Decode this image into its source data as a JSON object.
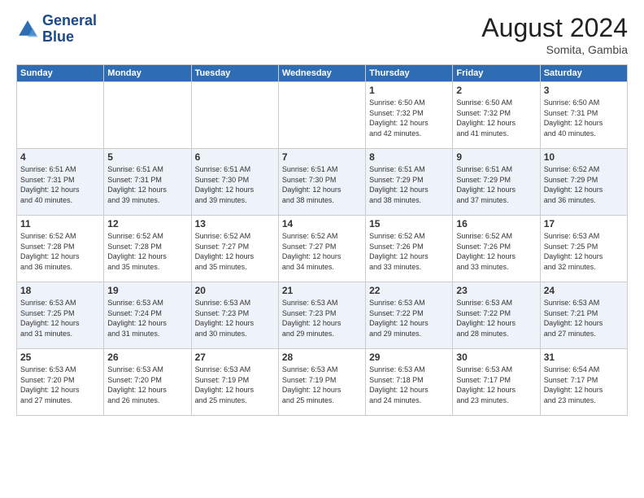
{
  "header": {
    "logo_line1": "General",
    "logo_line2": "Blue",
    "month_year": "August 2024",
    "location": "Somita, Gambia"
  },
  "weekdays": [
    "Sunday",
    "Monday",
    "Tuesday",
    "Wednesday",
    "Thursday",
    "Friday",
    "Saturday"
  ],
  "weeks": [
    [
      {
        "day": "",
        "info": ""
      },
      {
        "day": "",
        "info": ""
      },
      {
        "day": "",
        "info": ""
      },
      {
        "day": "",
        "info": ""
      },
      {
        "day": "1",
        "info": "Sunrise: 6:50 AM\nSunset: 7:32 PM\nDaylight: 12 hours\nand 42 minutes."
      },
      {
        "day": "2",
        "info": "Sunrise: 6:50 AM\nSunset: 7:32 PM\nDaylight: 12 hours\nand 41 minutes."
      },
      {
        "day": "3",
        "info": "Sunrise: 6:50 AM\nSunset: 7:31 PM\nDaylight: 12 hours\nand 40 minutes."
      }
    ],
    [
      {
        "day": "4",
        "info": "Sunrise: 6:51 AM\nSunset: 7:31 PM\nDaylight: 12 hours\nand 40 minutes."
      },
      {
        "day": "5",
        "info": "Sunrise: 6:51 AM\nSunset: 7:31 PM\nDaylight: 12 hours\nand 39 minutes."
      },
      {
        "day": "6",
        "info": "Sunrise: 6:51 AM\nSunset: 7:30 PM\nDaylight: 12 hours\nand 39 minutes."
      },
      {
        "day": "7",
        "info": "Sunrise: 6:51 AM\nSunset: 7:30 PM\nDaylight: 12 hours\nand 38 minutes."
      },
      {
        "day": "8",
        "info": "Sunrise: 6:51 AM\nSunset: 7:29 PM\nDaylight: 12 hours\nand 38 minutes."
      },
      {
        "day": "9",
        "info": "Sunrise: 6:51 AM\nSunset: 7:29 PM\nDaylight: 12 hours\nand 37 minutes."
      },
      {
        "day": "10",
        "info": "Sunrise: 6:52 AM\nSunset: 7:29 PM\nDaylight: 12 hours\nand 36 minutes."
      }
    ],
    [
      {
        "day": "11",
        "info": "Sunrise: 6:52 AM\nSunset: 7:28 PM\nDaylight: 12 hours\nand 36 minutes."
      },
      {
        "day": "12",
        "info": "Sunrise: 6:52 AM\nSunset: 7:28 PM\nDaylight: 12 hours\nand 35 minutes."
      },
      {
        "day": "13",
        "info": "Sunrise: 6:52 AM\nSunset: 7:27 PM\nDaylight: 12 hours\nand 35 minutes."
      },
      {
        "day": "14",
        "info": "Sunrise: 6:52 AM\nSunset: 7:27 PM\nDaylight: 12 hours\nand 34 minutes."
      },
      {
        "day": "15",
        "info": "Sunrise: 6:52 AM\nSunset: 7:26 PM\nDaylight: 12 hours\nand 33 minutes."
      },
      {
        "day": "16",
        "info": "Sunrise: 6:52 AM\nSunset: 7:26 PM\nDaylight: 12 hours\nand 33 minutes."
      },
      {
        "day": "17",
        "info": "Sunrise: 6:53 AM\nSunset: 7:25 PM\nDaylight: 12 hours\nand 32 minutes."
      }
    ],
    [
      {
        "day": "18",
        "info": "Sunrise: 6:53 AM\nSunset: 7:25 PM\nDaylight: 12 hours\nand 31 minutes."
      },
      {
        "day": "19",
        "info": "Sunrise: 6:53 AM\nSunset: 7:24 PM\nDaylight: 12 hours\nand 31 minutes."
      },
      {
        "day": "20",
        "info": "Sunrise: 6:53 AM\nSunset: 7:23 PM\nDaylight: 12 hours\nand 30 minutes."
      },
      {
        "day": "21",
        "info": "Sunrise: 6:53 AM\nSunset: 7:23 PM\nDaylight: 12 hours\nand 29 minutes."
      },
      {
        "day": "22",
        "info": "Sunrise: 6:53 AM\nSunset: 7:22 PM\nDaylight: 12 hours\nand 29 minutes."
      },
      {
        "day": "23",
        "info": "Sunrise: 6:53 AM\nSunset: 7:22 PM\nDaylight: 12 hours\nand 28 minutes."
      },
      {
        "day": "24",
        "info": "Sunrise: 6:53 AM\nSunset: 7:21 PM\nDaylight: 12 hours\nand 27 minutes."
      }
    ],
    [
      {
        "day": "25",
        "info": "Sunrise: 6:53 AM\nSunset: 7:20 PM\nDaylight: 12 hours\nand 27 minutes."
      },
      {
        "day": "26",
        "info": "Sunrise: 6:53 AM\nSunset: 7:20 PM\nDaylight: 12 hours\nand 26 minutes."
      },
      {
        "day": "27",
        "info": "Sunrise: 6:53 AM\nSunset: 7:19 PM\nDaylight: 12 hours\nand 25 minutes."
      },
      {
        "day": "28",
        "info": "Sunrise: 6:53 AM\nSunset: 7:19 PM\nDaylight: 12 hours\nand 25 minutes."
      },
      {
        "day": "29",
        "info": "Sunrise: 6:53 AM\nSunset: 7:18 PM\nDaylight: 12 hours\nand 24 minutes."
      },
      {
        "day": "30",
        "info": "Sunrise: 6:53 AM\nSunset: 7:17 PM\nDaylight: 12 hours\nand 23 minutes."
      },
      {
        "day": "31",
        "info": "Sunrise: 6:54 AM\nSunset: 7:17 PM\nDaylight: 12 hours\nand 23 minutes."
      }
    ]
  ]
}
